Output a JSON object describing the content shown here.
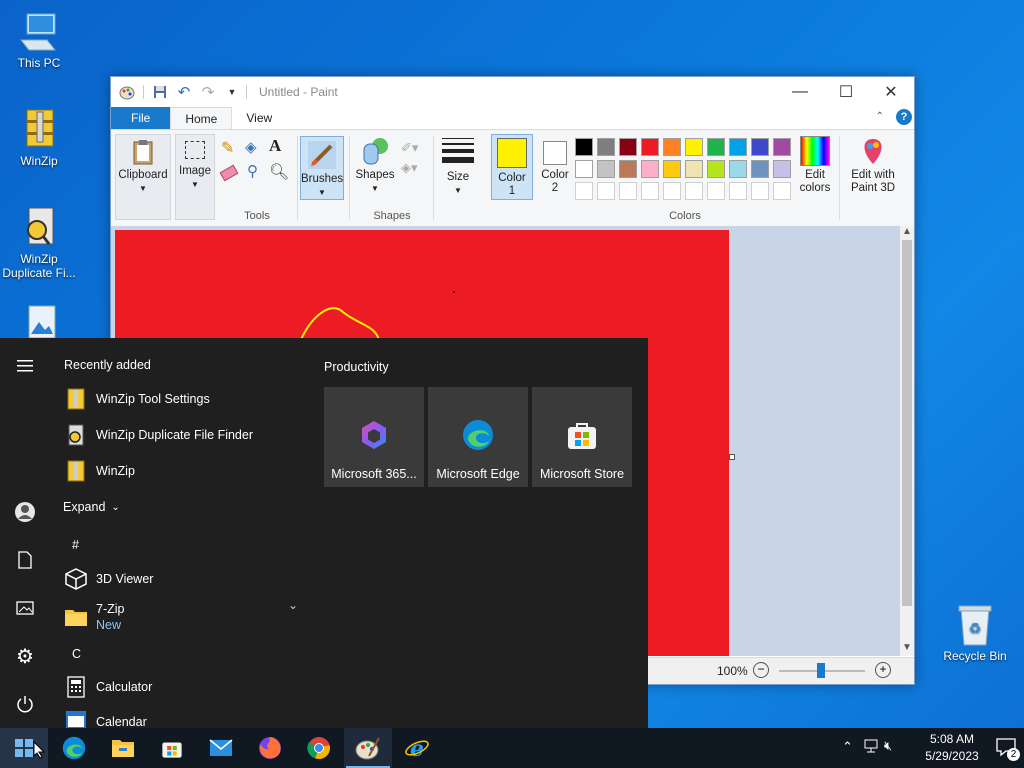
{
  "desktop": {
    "icons": [
      {
        "label": "This PC"
      },
      {
        "label": "WinZip"
      },
      {
        "label": "WinZip Duplicate Fi..."
      },
      {
        "label": "Recycle Bin"
      }
    ]
  },
  "paint": {
    "title": "Untitled - Paint",
    "tabs": {
      "file": "File",
      "home": "Home",
      "view": "View"
    },
    "ribbon": {
      "clipboard": "Clipboard",
      "image": "Image",
      "tools_group": "Tools",
      "brushes": "Brushes",
      "shapes": "Shapes",
      "shapes_group": "Shapes",
      "size": "Size",
      "color1": "Color 1",
      "color2": "Color 2",
      "colors_group": "Colors",
      "edit_colors": "Edit colors",
      "edit_paint3d": "Edit with Paint 3D"
    },
    "palette_row1": [
      "#000000",
      "#7f7f7f",
      "#880015",
      "#ed1c24",
      "#ff7f27",
      "#fff200",
      "#22b14c",
      "#00a2e8",
      "#3f48cc",
      "#a349a4"
    ],
    "palette_row2": [
      "#ffffff",
      "#c3c3c3",
      "#b97a57",
      "#ffaec9",
      "#ffc90e",
      "#efe4b0",
      "#b5e61d",
      "#99d9ea",
      "#7092be",
      "#c8bfe7"
    ],
    "color1_value": "#fff200",
    "color2_value": "#ffffff",
    "canvas_color": "#ed1c24",
    "zoom": "100%"
  },
  "start": {
    "recently_added": "Recently added",
    "recent": [
      {
        "label": "WinZip Tool Settings"
      },
      {
        "label": "WinZip Duplicate File Finder"
      },
      {
        "label": "WinZip"
      }
    ],
    "expand": "Expand",
    "sections": {
      "hash": "#",
      "c": "C"
    },
    "apps": [
      {
        "label": "3D Viewer"
      },
      {
        "label": "7-Zip",
        "sub": "New"
      },
      {
        "label": "Calculator"
      },
      {
        "label": "Calendar"
      }
    ],
    "productivity": "Productivity",
    "tiles": [
      {
        "label": "Microsoft 365..."
      },
      {
        "label": "Microsoft Edge"
      },
      {
        "label": "Microsoft Store"
      }
    ]
  },
  "tray": {
    "time": "5:08 AM",
    "date": "5/29/2023",
    "notifications": "2"
  }
}
